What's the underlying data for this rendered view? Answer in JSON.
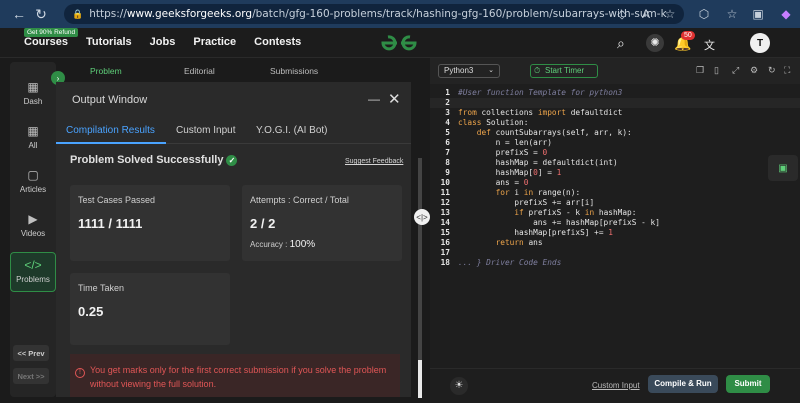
{
  "browser": {
    "url_prefix": "https://",
    "url_domain": "www.geeksforgeeks.org",
    "url_path": "/batch/gfg-160-problems/track/hashing-gfg-160/problem/subarrays-with-sum-k"
  },
  "topnav": {
    "refund_badge": "Get 90% Refund",
    "menu": [
      "Courses",
      "Tutorials",
      "Jobs",
      "Practice",
      "Contests"
    ],
    "notification_count": "50",
    "avatar_letter": "T"
  },
  "sidebar": {
    "items": [
      "Dash",
      "All",
      "Articles",
      "Videos",
      "Problems"
    ],
    "prev_label": "<< Prev",
    "next_label": "Next >>"
  },
  "problem_tabs": [
    "Problem",
    "Editorial",
    "Submissions"
  ],
  "output_window": {
    "title": "Output Window",
    "tabs": [
      "Compilation Results",
      "Custom Input",
      "Y.O.G.I. (AI Bot)"
    ],
    "status": "Problem Solved Successfully",
    "suggest_feedback": "Suggest Feedback",
    "test_cases_label": "Test Cases Passed",
    "test_cases_value": "1111 / 1111",
    "attempts_label": "Attempts : Correct / Total",
    "attempts_value": "2 / 2",
    "accuracy_label": "Accuracy :",
    "accuracy_value": "100%",
    "time_label": "Time Taken",
    "time_value": "0.25",
    "warning": "You get marks only for the first correct submission if you solve the problem without viewing the full solution."
  },
  "editor": {
    "language": "Python3",
    "start_timer": "Start Timer",
    "lines": [
      {
        "n": "1",
        "t": "#User function Template for python3"
      },
      {
        "n": "2",
        "t": ""
      },
      {
        "n": "3",
        "t": "from collections import defaultdict"
      },
      {
        "n": "4",
        "t": "class Solution:"
      },
      {
        "n": "5",
        "t": "    def countSubarrays(self, arr, k):"
      },
      {
        "n": "6",
        "t": "        n = len(arr)"
      },
      {
        "n": "7",
        "t": "        prefixS = 0"
      },
      {
        "n": "8",
        "t": "        hashMap = defaultdict(int)"
      },
      {
        "n": "9",
        "t": "        hashMap[0] = 1"
      },
      {
        "n": "10",
        "t": "        ans = 0"
      },
      {
        "n": "11",
        "t": "        for i in range(n):"
      },
      {
        "n": "12",
        "t": "            prefixS += arr[i]"
      },
      {
        "n": "13",
        "t": "            if prefixS - k in hashMap:"
      },
      {
        "n": "14",
        "t": "                ans += hashMap[prefixS - k]"
      },
      {
        "n": "15",
        "t": "            hashMap[prefixS] += 1"
      },
      {
        "n": "16",
        "t": "        return ans"
      },
      {
        "n": "17",
        "t": ""
      },
      {
        "n": "18",
        "t": "... } Driver Code Ends"
      }
    ],
    "custom_input": "Custom Input",
    "compile_run": "Compile & Run",
    "submit": "Submit"
  },
  "colors": {
    "brand_green": "#2f8d46",
    "accent_blue": "#4aa3ff",
    "warning_red": "#e05656"
  }
}
